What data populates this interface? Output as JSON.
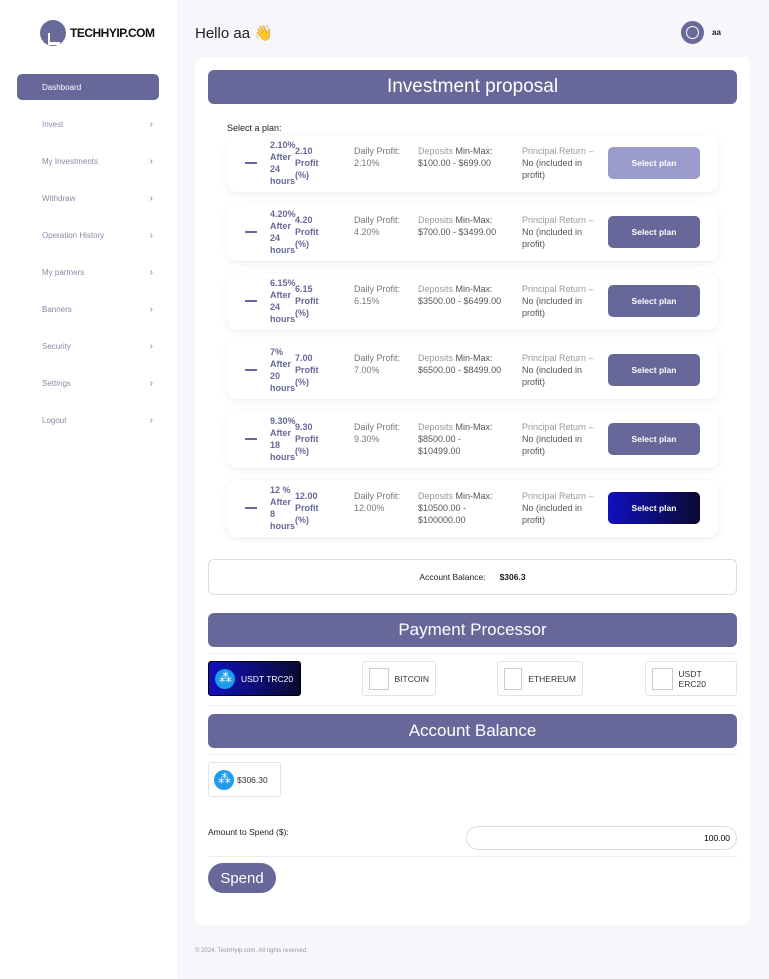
{
  "brand": {
    "name": "TECHHYIP.COM"
  },
  "sidebar": {
    "items": [
      {
        "label": "Dashboard",
        "active": true
      },
      {
        "label": "Invest"
      },
      {
        "label": "My Investments"
      },
      {
        "label": "Withdraw"
      },
      {
        "label": "Operation History"
      },
      {
        "label": "My partners"
      },
      {
        "label": "Banners"
      },
      {
        "label": "Security"
      },
      {
        "label": "Settings"
      },
      {
        "label": "Logout"
      }
    ]
  },
  "header": {
    "greeting": "Hello aa 👋",
    "username": "aa"
  },
  "proposal": {
    "title": "Investment proposal",
    "select_label": "Select a plan:",
    "plans": [
      {
        "t1": "2.10% After 24 hours",
        "t2": "2.10 Profit (%)",
        "daily_label": "Daily Profit:",
        "daily": "2.10%",
        "dep_label": "Deposits",
        "dep": "Min-Max: $100.00 - $699.00",
        "principal": "Principal Return –",
        "principal2": "No (included in profit)",
        "button": "Select plan"
      },
      {
        "t1": "4.20% After 24 hours",
        "t2": "4.20 Profit (%)",
        "daily_label": "Daily Profit:",
        "daily": "4.20%",
        "dep_label": "Deposits",
        "dep": "Min-Max: $700.00 - $3499.00",
        "principal": "Principal Return –",
        "principal2": "No (included in profit)",
        "button": "Select plan"
      },
      {
        "t1": "6.15% After 24 hours",
        "t2": "6.15 Profit (%)",
        "daily_label": "Daily Profit:",
        "daily": "6.15%",
        "dep_label": "Deposits",
        "dep": "Min-Max: $3500.00 - $6499.00",
        "principal": "Principal Return –",
        "principal2": "No (included in profit)",
        "button": "Select plan"
      },
      {
        "t1": "7% After 20 hours",
        "t2": "7.00 Profit (%)",
        "daily_label": "Daily Profit:",
        "daily": "7.00%",
        "dep_label": "Deposits",
        "dep": "Min-Max: $6500.00 - $8499.00",
        "principal": "Principal Return –",
        "principal2": "No (included in profit)",
        "button": "Select plan"
      },
      {
        "t1": "9.30% After 18 hours",
        "t2": "9.30 Profit (%)",
        "daily_label": "Daily Profit:",
        "daily": "9.30%",
        "dep_label": "Deposits",
        "dep": "Min-Max: $8500.00 - $10499.00",
        "principal": "Principal Return –",
        "principal2": "No (included in profit)",
        "button": "Select plan"
      },
      {
        "t1": "12 % After 8 hours",
        "t2": "12.00 Profit (%)",
        "daily_label": "Daily Profit:",
        "daily": "12.00%",
        "dep_label": "Deposits",
        "dep": "Min-Max: $10500.00 - $100000.00",
        "principal": "Principal Return –",
        "principal2": "No (included in profit)",
        "button": "Select plan"
      }
    ]
  },
  "account": {
    "label": "Account Balance:",
    "value": "$306.3"
  },
  "payment": {
    "title": "Payment Processor",
    "options": [
      "USDT TRC20",
      "BITCOIN",
      "ETHEREUM",
      "USDT ERC20"
    ],
    "selected": "USDT TRC20"
  },
  "balance_section": {
    "title": "Account Balance",
    "value": "$306.30"
  },
  "amount": {
    "label": "Amount to Spend ($):",
    "value": "100.00"
  },
  "spend_label": "Spend",
  "footer": "© 2024, TechHyip.com. All rights reserved.",
  "colors": {
    "accent": "#67679a",
    "button_disabled": "#9a9acb",
    "selected_gradient_start": "#1010c0"
  }
}
